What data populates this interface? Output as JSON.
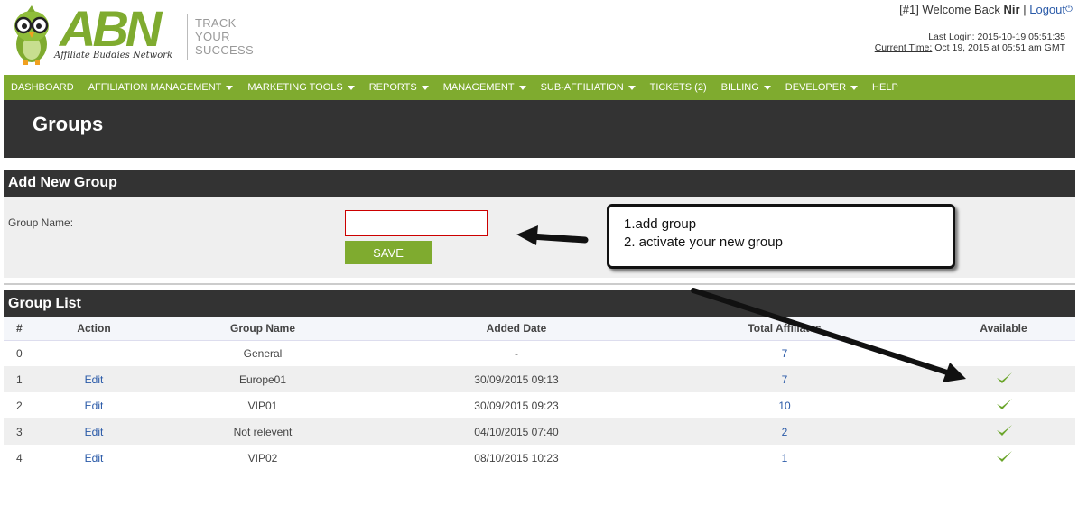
{
  "header": {
    "logo_text": "ABN",
    "logo_subtitle": "Affiliate Buddies Network",
    "tagline": [
      "TRACK",
      "YOUR",
      "SUCCESS"
    ],
    "welcome_prefix": "[#1] Welcome Back",
    "username": "Nir",
    "separator": "|",
    "logout_label": "Logout",
    "last_login_label": "Last Login:",
    "last_login_value": "2015-10-19 05:51:35",
    "current_time_label": "Current Time:",
    "current_time_value": "Oct 19, 2015 at 05:51 am GMT"
  },
  "nav": {
    "items": [
      {
        "label": "DASHBOARD",
        "dropdown": false
      },
      {
        "label": "AFFILIATION MANAGEMENT",
        "dropdown": true
      },
      {
        "label": "MARKETING TOOLS",
        "dropdown": true
      },
      {
        "label": "REPORTS",
        "dropdown": true
      },
      {
        "label": "MANAGEMENT",
        "dropdown": true
      },
      {
        "label": "SUB-AFFILIATION",
        "dropdown": true
      },
      {
        "label": "TICKETS (2)",
        "dropdown": false
      },
      {
        "label": "BILLING",
        "dropdown": true
      },
      {
        "label": "DEVELOPER",
        "dropdown": true
      },
      {
        "label": "HELP",
        "dropdown": false
      }
    ]
  },
  "page": {
    "title": "Groups"
  },
  "add_group": {
    "heading": "Add New Group",
    "field_label": "Group Name:",
    "field_value": "",
    "save_label": "SAVE"
  },
  "callout": {
    "line1": "1.add group",
    "line2": "2. activate your new group"
  },
  "group_list": {
    "heading": "Group List",
    "columns": [
      "#",
      "Action",
      "Group Name",
      "Added Date",
      "Total Affiliates",
      "Available"
    ],
    "rows": [
      {
        "id": "0",
        "action": "",
        "name": "General",
        "date": "-",
        "total": "7",
        "available": false
      },
      {
        "id": "1",
        "action": "Edit",
        "name": "Europe01",
        "date": "30/09/2015 09:13",
        "total": "7",
        "available": true
      },
      {
        "id": "2",
        "action": "Edit",
        "name": "VIP01",
        "date": "30/09/2015 09:23",
        "total": "10",
        "available": true
      },
      {
        "id": "3",
        "action": "Edit",
        "name": "Not relevent",
        "date": "04/10/2015 07:40",
        "total": "2",
        "available": true
      },
      {
        "id": "4",
        "action": "Edit",
        "name": "VIP02",
        "date": "08/10/2015 10:23",
        "total": "1",
        "available": true
      }
    ]
  },
  "colors": {
    "brand_green": "#7fab2f",
    "dark_bar": "#333333",
    "link_blue": "#2a5aa8",
    "input_border": "#cc0000"
  }
}
